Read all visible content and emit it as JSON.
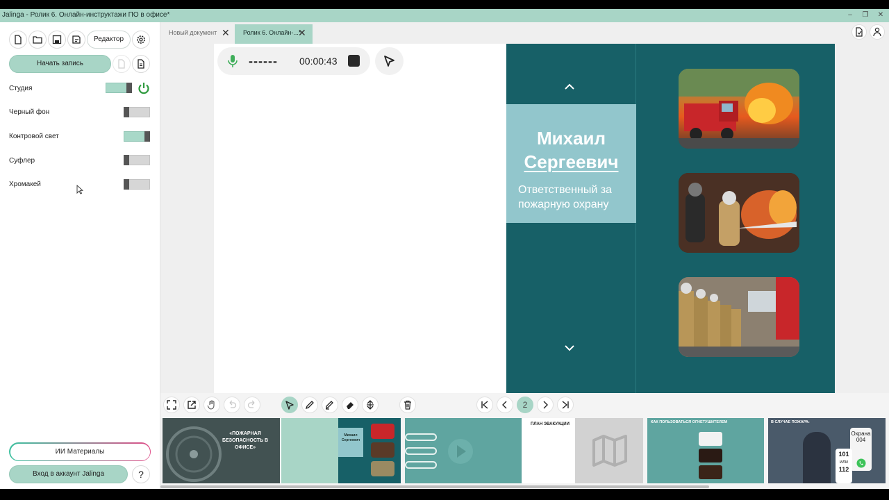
{
  "window": {
    "title": "Jalinga - Ролик 6. Онлайн-инструктажи ПО в офисе*"
  },
  "toolbar": {
    "editor_label": "Редактор",
    "start_record_label": "Начать запись"
  },
  "settings": [
    {
      "label": "Студия",
      "on": true
    },
    {
      "label": "Черный фон",
      "on": false
    },
    {
      "label": "Контровой свет",
      "on": true
    },
    {
      "label": "Суфлер",
      "on": false
    },
    {
      "label": "Хромакей",
      "on": false
    }
  ],
  "sidebar_bottom": {
    "ai_materials_label": "ИИ Материалы",
    "login_label": "Вход в аккаунт Jalinga",
    "help_label": "?"
  },
  "tabs": [
    {
      "label": "Новый документ",
      "active": false
    },
    {
      "label": "Ролик 6. Онлайн-...*",
      "active": true
    }
  ],
  "recorder": {
    "level_text": "------",
    "timer": "00:00:43"
  },
  "slide": {
    "name_line1": "Михаил",
    "name_line2": "Сергеевич",
    "role": "Ответственный за пожарную охрану",
    "colors": {
      "bg": "#176067",
      "box": "#92c6cc"
    }
  },
  "pager": {
    "current_page": "2"
  },
  "thumbnails": {
    "t1_text": "«ПОЖАРНАЯ БЕЗОПАСНОСТЬ В ОФИСЕ»",
    "t2_name": "Михаил Сергеевич",
    "t4_title": "ПЛАН ЭВАКУАЦИИ",
    "t5_title": "КАК ПОЛЬЗОВАТЬСЯ ОГНЕТУШИТЕЛЕМ",
    "t6_title": "В СЛУЧАЕ ПОЖАРА:",
    "t6_card_title": "Охрана",
    "t6_card_num": "004",
    "t6_phone1": "101",
    "t6_phone_or": "или",
    "t6_phone2": "112"
  },
  "colors": {
    "accent": "#a8d5c6",
    "power_green": "#2e9a3e",
    "mic_green": "#3fae5a",
    "ai_gradient_left": "#3ec1a0",
    "ai_gradient_right": "#e0508a"
  }
}
